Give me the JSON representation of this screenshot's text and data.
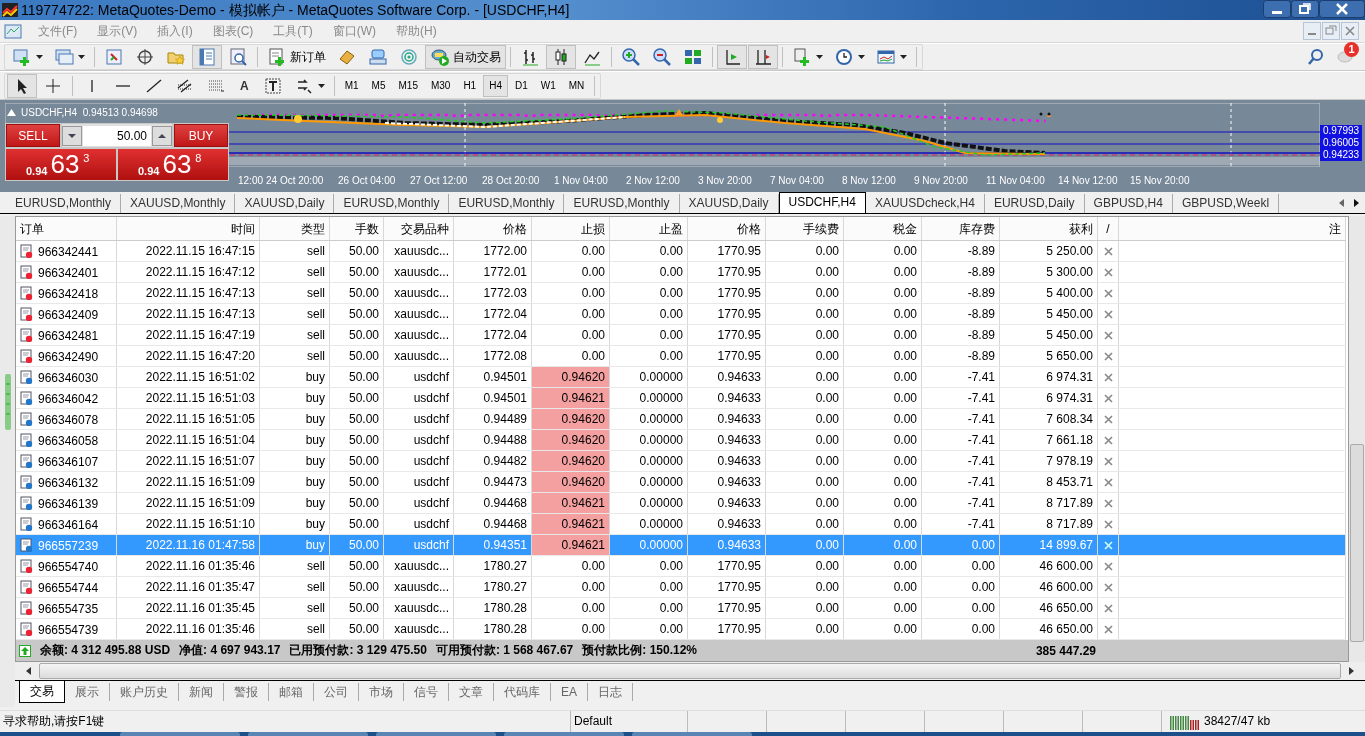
{
  "window": {
    "title": "119774722: MetaQuotes-Demo - 模拟帐户 - MetaQuotes Software Corp. - [USDCHF,H4]"
  },
  "menu": [
    "文件(F)",
    "显示(V)",
    "插入(I)",
    "图表(C)",
    "工具(T)",
    "窗口(W)",
    "帮助(H)"
  ],
  "toolbar": {
    "new_order": "新订单",
    "auto_trading": "自动交易",
    "text_tool": "A",
    "notifications": "1"
  },
  "timeframes": [
    {
      "label": "M1",
      "selected": false
    },
    {
      "label": "M5",
      "selected": false
    },
    {
      "label": "M15",
      "selected": false
    },
    {
      "label": "M30",
      "selected": false
    },
    {
      "label": "H1",
      "selected": false
    },
    {
      "label": "H4",
      "selected": true
    },
    {
      "label": "D1",
      "selected": false
    },
    {
      "label": "W1",
      "selected": false
    },
    {
      "label": "MN",
      "selected": false
    }
  ],
  "chart": {
    "header": "USDCHF,H4  0.94513 0.94698",
    "trade_panel": {
      "sell": "SELL",
      "buy": "BUY",
      "lots": "50.00",
      "bid": {
        "big": "0.94",
        "pips": "63",
        "point": "3"
      },
      "ask": {
        "big": "0.94",
        "pips": "63",
        "point": "8"
      }
    },
    "price_labels": [
      "0.97993",
      "0.96005",
      "0.94233"
    ],
    "time_labels": [
      "12:00",
      "24 Oct 20:00",
      "26 Oct 04:00",
      "27 Oct 12:00",
      "28 Oct 20:00",
      "1 Nov 04:00",
      "2 Nov 12:00",
      "3 Nov 20:00",
      "7 Nov 04:00",
      "8 Nov 12:00",
      "9 Nov 20:00",
      "11 Nov 04:00",
      "14 Nov 12:00",
      "15 Nov 20:00"
    ]
  },
  "chart_tabs": [
    {
      "label": "EURUSD,Monthly",
      "selected": false
    },
    {
      "label": "XAUUSD,Monthly",
      "selected": false
    },
    {
      "label": "XAUUSD,Daily",
      "selected": false
    },
    {
      "label": "EURUSD,Monthly",
      "selected": false
    },
    {
      "label": "EURUSD,Monthly",
      "selected": false
    },
    {
      "label": "EURUSD,Monthly",
      "selected": false
    },
    {
      "label": "XAUUSD,Daily",
      "selected": false
    },
    {
      "label": "USDCHF,H4",
      "selected": true
    },
    {
      "label": "XAUUSDcheck,H4",
      "selected": false
    },
    {
      "label": "EURUSD,Daily",
      "selected": false
    },
    {
      "label": "GBPUSD,H4",
      "selected": false
    },
    {
      "label": "GBPUSD,Weekl",
      "selected": false
    }
  ],
  "table": {
    "columns": [
      "订单",
      "时间",
      "类型",
      "手数",
      "交易品种",
      "价格",
      "止损",
      "止盈",
      "价格",
      "手续费",
      "税金",
      "库存费",
      "获利",
      "/",
      "注"
    ],
    "rows": [
      {
        "kind": "sell",
        "selected": false,
        "sl_near": false,
        "cells": [
          "966342441",
          "2022.11.15 16:47:15",
          "sell",
          "50.00",
          "xauusdc...",
          "1772.00",
          "0.00",
          "0.00",
          "1770.95",
          "0.00",
          "0.00",
          "-8.89",
          "5 250.00"
        ]
      },
      {
        "kind": "sell",
        "selected": false,
        "sl_near": false,
        "cells": [
          "966342401",
          "2022.11.15 16:47:12",
          "sell",
          "50.00",
          "xauusdc...",
          "1772.01",
          "0.00",
          "0.00",
          "1770.95",
          "0.00",
          "0.00",
          "-8.89",
          "5 300.00"
        ]
      },
      {
        "kind": "sell",
        "selected": false,
        "sl_near": false,
        "cells": [
          "966342418",
          "2022.11.15 16:47:13",
          "sell",
          "50.00",
          "xauusdc...",
          "1772.03",
          "0.00",
          "0.00",
          "1770.95",
          "0.00",
          "0.00",
          "-8.89",
          "5 400.00"
        ]
      },
      {
        "kind": "sell",
        "selected": false,
        "sl_near": false,
        "cells": [
          "966342409",
          "2022.11.15 16:47:13",
          "sell",
          "50.00",
          "xauusdc...",
          "1772.04",
          "0.00",
          "0.00",
          "1770.95",
          "0.00",
          "0.00",
          "-8.89",
          "5 450.00"
        ]
      },
      {
        "kind": "sell",
        "selected": false,
        "sl_near": false,
        "cells": [
          "966342481",
          "2022.11.15 16:47:19",
          "sell",
          "50.00",
          "xauusdc...",
          "1772.04",
          "0.00",
          "0.00",
          "1770.95",
          "0.00",
          "0.00",
          "-8.89",
          "5 450.00"
        ]
      },
      {
        "kind": "sell",
        "selected": false,
        "sl_near": false,
        "cells": [
          "966342490",
          "2022.11.15 16:47:20",
          "sell",
          "50.00",
          "xauusdc...",
          "1772.08",
          "0.00",
          "0.00",
          "1770.95",
          "0.00",
          "0.00",
          "-8.89",
          "5 650.00"
        ]
      },
      {
        "kind": "buy",
        "selected": false,
        "sl_near": true,
        "cells": [
          "966346030",
          "2022.11.15 16:51:02",
          "buy",
          "50.00",
          "usdchf",
          "0.94501",
          "0.94620",
          "0.00000",
          "0.94633",
          "0.00",
          "0.00",
          "-7.41",
          "6 974.31"
        ]
      },
      {
        "kind": "buy",
        "selected": false,
        "sl_near": true,
        "cells": [
          "966346042",
          "2022.11.15 16:51:03",
          "buy",
          "50.00",
          "usdchf",
          "0.94501",
          "0.94621",
          "0.00000",
          "0.94633",
          "0.00",
          "0.00",
          "-7.41",
          "6 974.31"
        ]
      },
      {
        "kind": "buy",
        "selected": false,
        "sl_near": true,
        "cells": [
          "966346078",
          "2022.11.15 16:51:05",
          "buy",
          "50.00",
          "usdchf",
          "0.94489",
          "0.94620",
          "0.00000",
          "0.94633",
          "0.00",
          "0.00",
          "-7.41",
          "7 608.34"
        ]
      },
      {
        "kind": "buy",
        "selected": false,
        "sl_near": true,
        "cells": [
          "966346058",
          "2022.11.15 16:51:04",
          "buy",
          "50.00",
          "usdchf",
          "0.94488",
          "0.94620",
          "0.00000",
          "0.94633",
          "0.00",
          "0.00",
          "-7.41",
          "7 661.18"
        ]
      },
      {
        "kind": "buy",
        "selected": false,
        "sl_near": true,
        "cells": [
          "966346107",
          "2022.11.15 16:51:07",
          "buy",
          "50.00",
          "usdchf",
          "0.94482",
          "0.94620",
          "0.00000",
          "0.94633",
          "0.00",
          "0.00",
          "-7.41",
          "7 978.19"
        ]
      },
      {
        "kind": "buy",
        "selected": false,
        "sl_near": true,
        "cells": [
          "966346132",
          "2022.11.15 16:51:09",
          "buy",
          "50.00",
          "usdchf",
          "0.94473",
          "0.94620",
          "0.00000",
          "0.94633",
          "0.00",
          "0.00",
          "-7.41",
          "8 453.71"
        ]
      },
      {
        "kind": "buy",
        "selected": false,
        "sl_near": true,
        "cells": [
          "966346139",
          "2022.11.15 16:51:09",
          "buy",
          "50.00",
          "usdchf",
          "0.94468",
          "0.94621",
          "0.00000",
          "0.94633",
          "0.00",
          "0.00",
          "-7.41",
          "8 717.89"
        ]
      },
      {
        "kind": "buy",
        "selected": false,
        "sl_near": true,
        "cells": [
          "966346164",
          "2022.11.15 16:51:10",
          "buy",
          "50.00",
          "usdchf",
          "0.94468",
          "0.94621",
          "0.00000",
          "0.94633",
          "0.00",
          "0.00",
          "-7.41",
          "8 717.89"
        ]
      },
      {
        "kind": "buy",
        "selected": true,
        "sl_near": true,
        "cells": [
          "966557239",
          "2022.11.16 01:47:58",
          "buy",
          "50.00",
          "usdchf",
          "0.94351",
          "0.94621",
          "0.00000",
          "0.94633",
          "0.00",
          "0.00",
          "0.00",
          "14 899.67"
        ]
      },
      {
        "kind": "sell",
        "selected": false,
        "sl_near": false,
        "cells": [
          "966554740",
          "2022.11.16 01:35:46",
          "sell",
          "50.00",
          "xauusdc...",
          "1780.27",
          "0.00",
          "0.00",
          "1770.95",
          "0.00",
          "0.00",
          "0.00",
          "46 600.00"
        ]
      },
      {
        "kind": "sell",
        "selected": false,
        "sl_near": false,
        "cells": [
          "966554744",
          "2022.11.16 01:35:47",
          "sell",
          "50.00",
          "xauusdc...",
          "1780.27",
          "0.00",
          "0.00",
          "1770.95",
          "0.00",
          "0.00",
          "0.00",
          "46 600.00"
        ]
      },
      {
        "kind": "sell",
        "selected": false,
        "sl_near": false,
        "cells": [
          "966554735",
          "2022.11.16 01:35:45",
          "sell",
          "50.00",
          "xauusdc...",
          "1780.28",
          "0.00",
          "0.00",
          "1770.95",
          "0.00",
          "0.00",
          "0.00",
          "46 650.00"
        ]
      },
      {
        "kind": "sell",
        "selected": false,
        "sl_near": false,
        "cells": [
          "966554739",
          "2022.11.16 01:35:46",
          "sell",
          "50.00",
          "xauusdc...",
          "1780.28",
          "0.00",
          "0.00",
          "1770.95",
          "0.00",
          "0.00",
          "0.00",
          "46 650.00"
        ]
      }
    ],
    "summary": {
      "items": [
        "余额: 4 312 495.88 USD",
        "净值: 4 697 943.17",
        "已用预付款: 3 129 475.50",
        "可用预付款: 1 568 467.67",
        "预付款比例: 150.12%"
      ],
      "total_profit": "385 447.29"
    }
  },
  "terminal_tabs": [
    {
      "label": "交易",
      "selected": true
    },
    {
      "label": "展示",
      "selected": false
    },
    {
      "label": "账户历史",
      "selected": false
    },
    {
      "label": "新闻",
      "selected": false
    },
    {
      "label": "警报",
      "selected": false
    },
    {
      "label": "邮箱",
      "selected": false
    },
    {
      "label": "公司",
      "selected": false
    },
    {
      "label": "市场",
      "selected": false
    },
    {
      "label": "信号",
      "selected": false
    },
    {
      "label": "文章",
      "selected": false
    },
    {
      "label": "代码库",
      "selected": false
    },
    {
      "label": "EA",
      "selected": false
    },
    {
      "label": "日志",
      "selected": false
    }
  ],
  "status_bar": {
    "help": "寻求帮助,请按F1键",
    "profile": "Default",
    "traffic": "38427/47 kb"
  }
}
